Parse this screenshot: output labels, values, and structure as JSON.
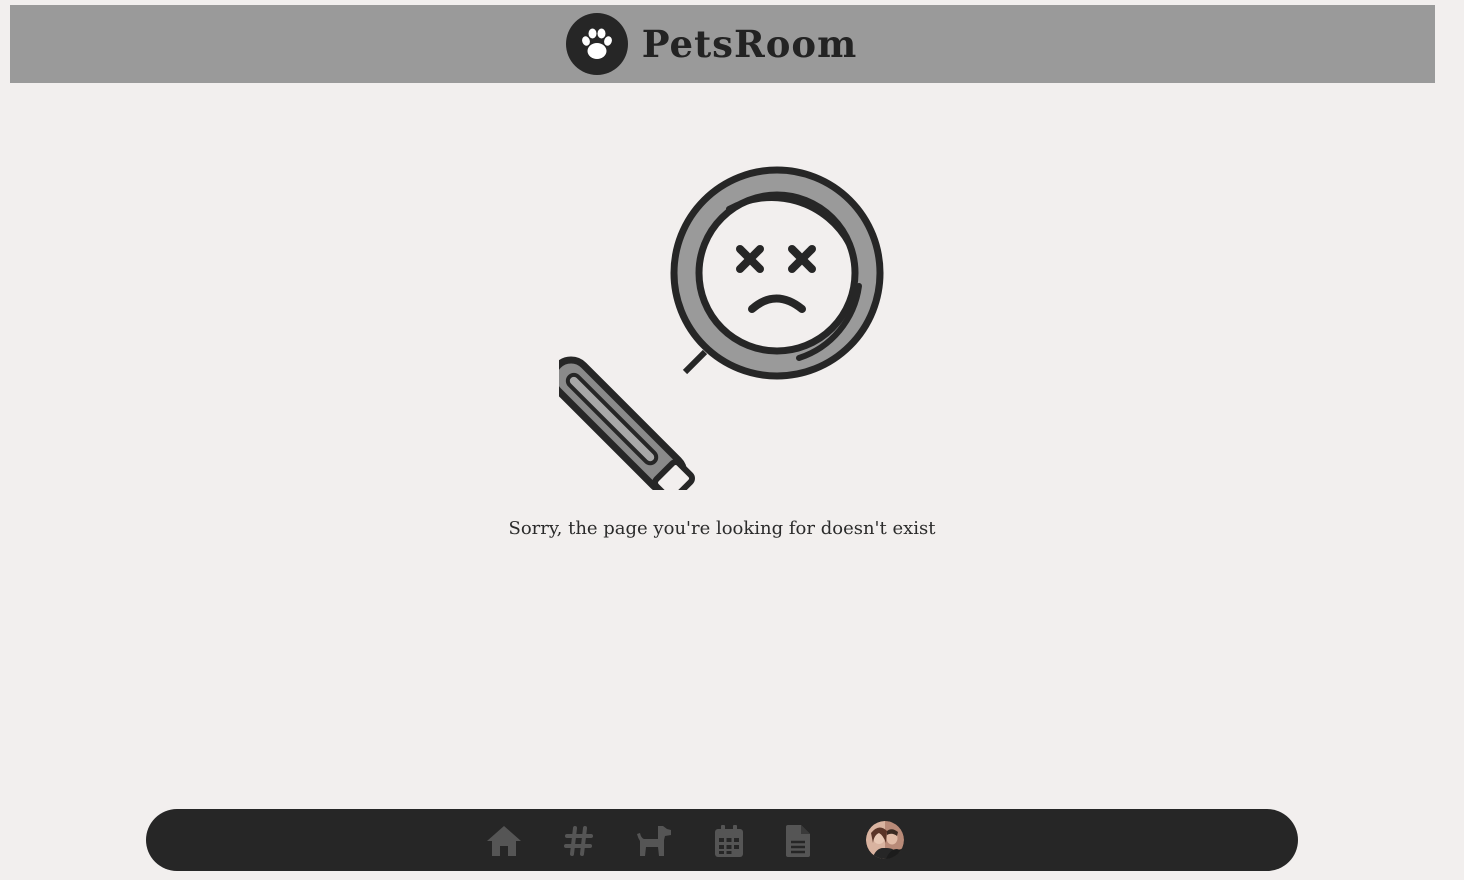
{
  "header": {
    "brand_name": "PetsRoom",
    "logo_icon": "paw-icon"
  },
  "error": {
    "illustration_icon": "magnifier-sad-face-icon",
    "message": "Sorry, the page you're looking for doesn't exist"
  },
  "bottom_nav": {
    "items": [
      {
        "icon": "home-icon"
      },
      {
        "icon": "hashtag-icon"
      },
      {
        "icon": "dog-icon"
      },
      {
        "icon": "calendar-icon"
      },
      {
        "icon": "document-icon"
      },
      {
        "icon": "user-avatar"
      }
    ]
  },
  "colors": {
    "background": "#f2efee",
    "header_bg": "#9a9a9a",
    "dark": "#262626",
    "nav_icon": "#555555"
  }
}
